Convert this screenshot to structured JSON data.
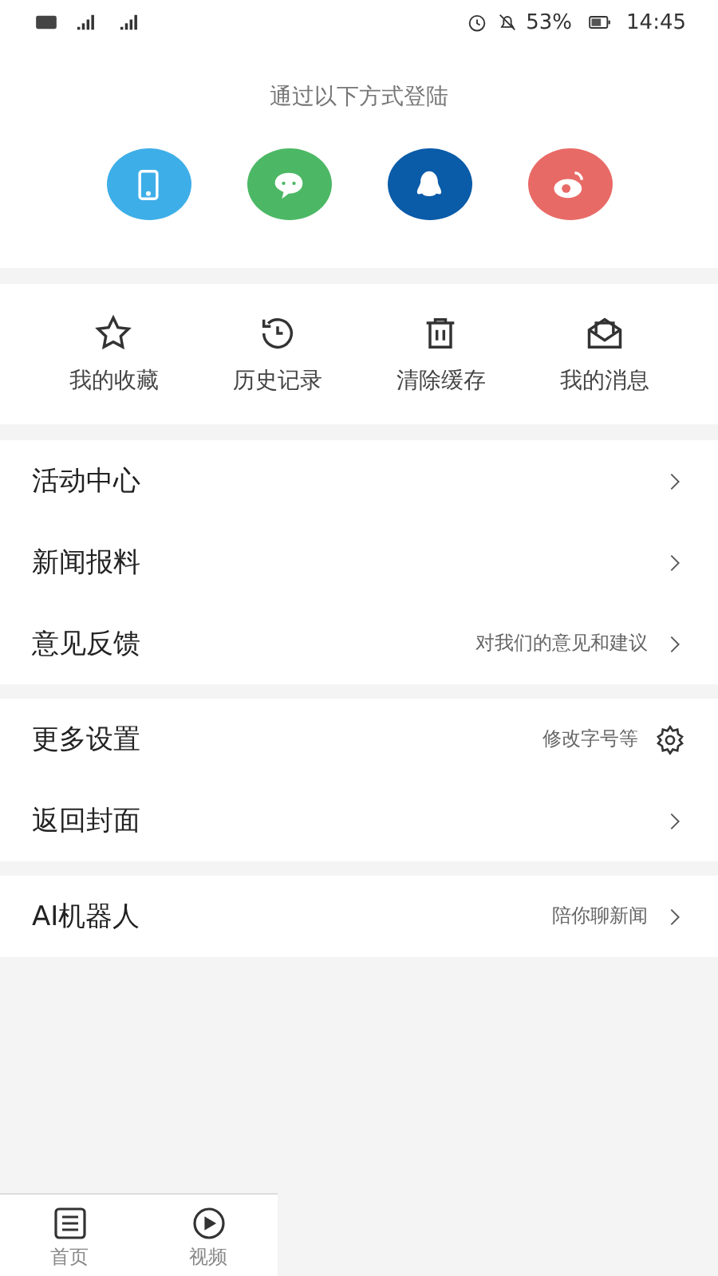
{
  "status_bar": {
    "battery": "53%",
    "time": "14:45"
  },
  "login": {
    "title": "通过以下方式登陆",
    "methods": [
      {
        "kind": "phone",
        "color": "#3eaee8"
      },
      {
        "kind": "chat",
        "color": "#4cb865"
      },
      {
        "kind": "penguin",
        "color": "#0a5ba8"
      },
      {
        "kind": "eye",
        "color": "#e86a66"
      }
    ]
  },
  "shortcuts": [
    {
      "kind": "star",
      "label": "我的收藏"
    },
    {
      "kind": "history",
      "label": "历史记录"
    },
    {
      "kind": "trash",
      "label": "清除缓存"
    },
    {
      "kind": "mail",
      "label": "我的消息"
    }
  ],
  "menu_groups": [
    [
      {
        "title": "活动中心",
        "kind": "arrow"
      },
      {
        "title": "新闻报料",
        "kind": "arrow"
      },
      {
        "title": "意见反馈",
        "hint": "对我们的意见和建议",
        "kind": "arrow"
      }
    ],
    [
      {
        "title": "更多设置",
        "hint": "修改字号等",
        "kind": "gear"
      },
      {
        "title": "返回封面",
        "kind": "arrow"
      }
    ],
    [
      {
        "title": "AI机器人",
        "hint": "陪你聊新闻",
        "kind": "arrow"
      }
    ]
  ],
  "tab_bar": [
    {
      "kind": "list",
      "label": "首页"
    },
    {
      "kind": "play",
      "label": "视频"
    }
  ]
}
